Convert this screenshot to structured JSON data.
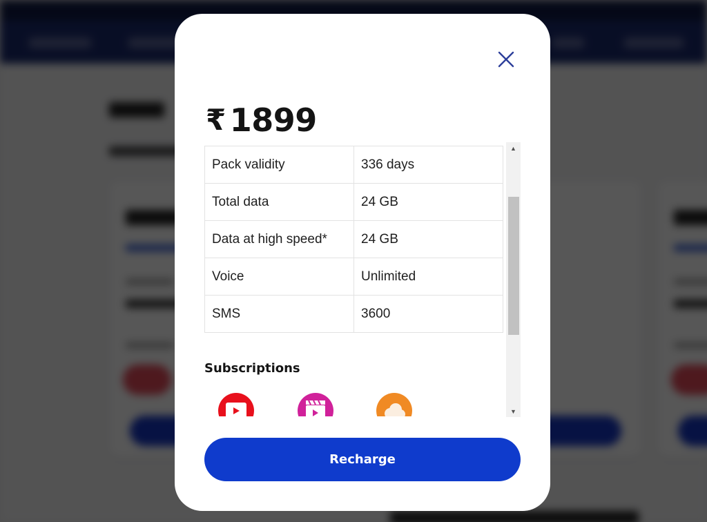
{
  "modal": {
    "currency_symbol": "₹",
    "price": "1899",
    "details": [
      {
        "label": "Pack validity",
        "value": "336 days"
      },
      {
        "label": "Total data",
        "value": "24 GB"
      },
      {
        "label": "Data at high speed*",
        "value": "24 GB"
      },
      {
        "label": "Voice",
        "value": "Unlimited"
      },
      {
        "label": "SMS",
        "value": "3600"
      }
    ],
    "subscriptions_title": "Subscriptions",
    "subscriptions": [
      {
        "icon": "video-streaming-app-icon",
        "color": "#e8101c"
      },
      {
        "icon": "movie-clapper-app-icon",
        "color": "#d0219a"
      },
      {
        "icon": "cloud-app-icon",
        "color": "#f08a24"
      }
    ],
    "recharge_label": "Recharge",
    "close_icon": "close-icon",
    "accent_color": "#0f3bcc",
    "close_icon_color": "#2c3e9a"
  },
  "scrollbar": {
    "scroll_position_fraction": 0.17,
    "visible_fraction": 0.55
  }
}
